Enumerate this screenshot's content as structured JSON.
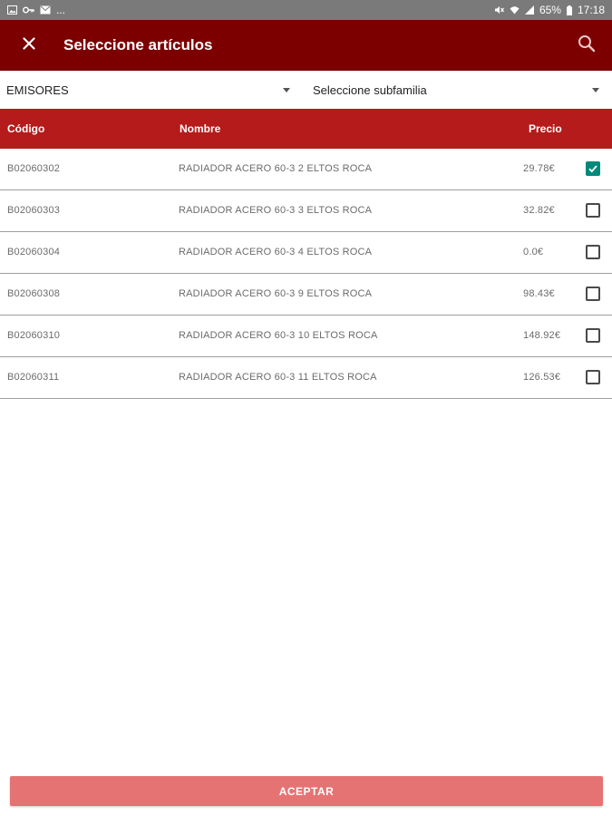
{
  "status_bar": {
    "left_icons": [
      "image-icon",
      "key-icon",
      "mail-icon"
    ],
    "overflow": "...",
    "right_icons": [
      "mute-icon",
      "wifi-icon",
      "signal-icon"
    ],
    "battery": "65%",
    "time": "17:18"
  },
  "app_bar": {
    "title": "Seleccione artículos",
    "close_icon": "close-icon",
    "search_icon": "search-icon",
    "color": "#7d0000"
  },
  "filters": {
    "family": "EMISORES",
    "subfamily": "Seleccione subfamilia"
  },
  "table": {
    "header_color": "#b51b1b",
    "columns": {
      "code": "Código",
      "name": "Nombre",
      "price": "Precio"
    },
    "rows": [
      {
        "code": "B02060302",
        "name": "RADIADOR ACERO 60-3 2 ELTOS ROCA",
        "price": "29.78€",
        "checked": true
      },
      {
        "code": "B02060303",
        "name": "RADIADOR ACERO 60-3 3 ELTOS ROCA",
        "price": "32.82€",
        "checked": false
      },
      {
        "code": "B02060304",
        "name": "RADIADOR ACERO 60-3 4 ELTOS ROCA",
        "price": "0.0€",
        "checked": false
      },
      {
        "code": "B02060308",
        "name": "RADIADOR ACERO 60-3 9 ELTOS ROCA",
        "price": "98.43€",
        "checked": false
      },
      {
        "code": "B02060310",
        "name": "RADIADOR ACERO 60-3 10 ELTOS ROCA",
        "price": "148.92€",
        "checked": false
      },
      {
        "code": "B02060311",
        "name": "RADIADOR ACERO 60-3 11 ELTOS ROCA",
        "price": "126.53€",
        "checked": false
      }
    ]
  },
  "footer": {
    "accept_label": "ACEPTAR",
    "accept_color": "#e57373"
  },
  "check_color": "#00897b"
}
